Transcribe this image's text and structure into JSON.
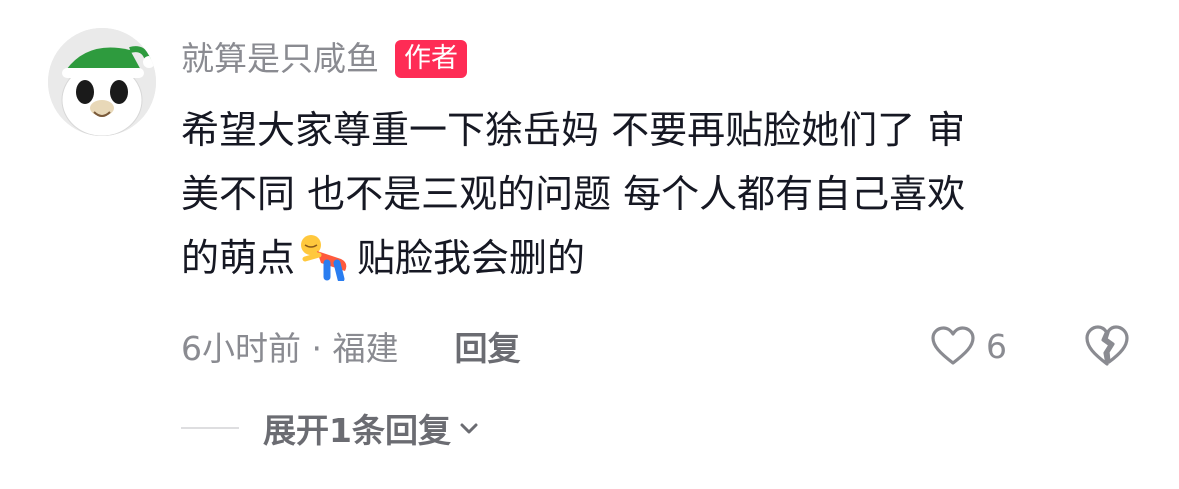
{
  "comment": {
    "username": "就算是只咸鱼",
    "author_badge": "作者",
    "text_lines": [
      "希望大家尊重一下狳岳妈 不要再贴脸她们了 审",
      "美不同 也不是三观的问题 每个人都有自己喜欢",
      "的萌点"
    ],
    "text_after_emoji": "贴脸我会删的",
    "inline_emoji": "lying-down-emoji",
    "meta": "6小时前 · 福建",
    "reply_label": "回复",
    "like_count": "6",
    "expand_replies_label": "展开1条回复"
  },
  "icons": {
    "avatar": "panda-with-green-hat-avatar",
    "like": "heart-outline-icon",
    "dislike": "broken-heart-icon",
    "expand": "chevron-down-icon"
  },
  "colors": {
    "badge_bg": "#fe2c55",
    "muted_text": "#8a8b91",
    "body_text": "#161823"
  }
}
